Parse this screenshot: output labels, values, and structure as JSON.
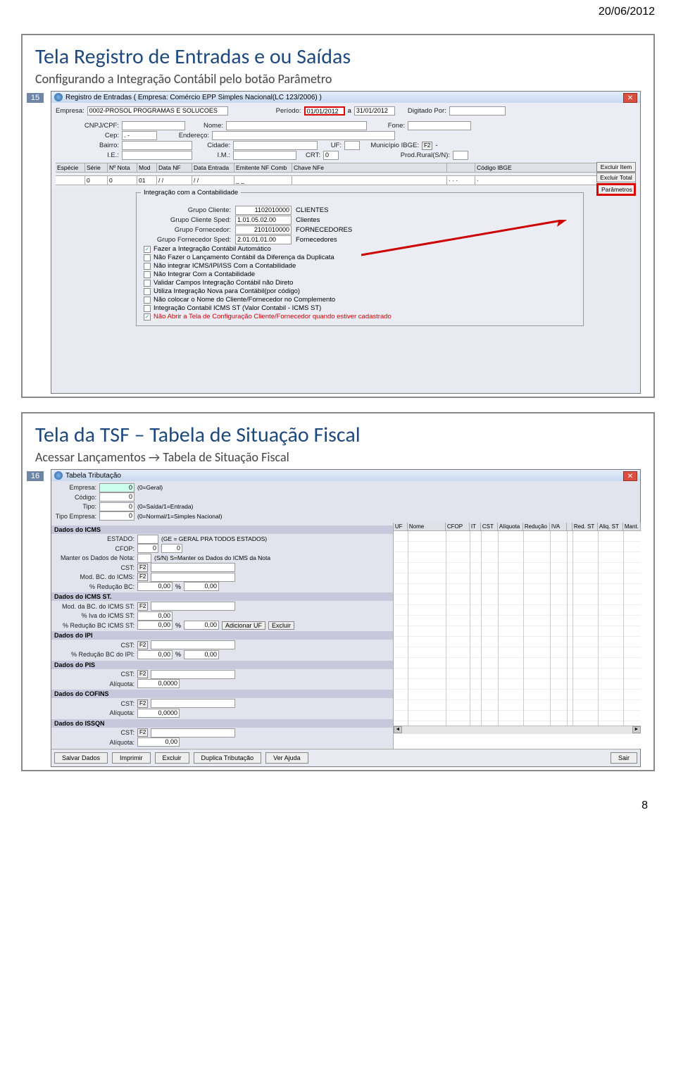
{
  "page": {
    "date": "20/06/2012",
    "footer_num": "8"
  },
  "slide1": {
    "num": "15",
    "title": "Tela Registro de Entradas  e ou Saídas",
    "subtitle": "Configurando  a Integração Contábil pelo botão Parâmetro",
    "win_title": "Registro de Entradas ( Empresa: Comércio  EPP Simples Nacional(LC 123/2006) )",
    "empresa_lbl": "Empresa:",
    "empresa_val": "0002-PROSOL PROGRAMAS E SOLUCOES",
    "periodo_lbl": "Período:",
    "periodo_de": "01/01/2012",
    "periodo_a_lbl": "a",
    "periodo_ate": "31/01/2012",
    "digitado_lbl": "Digitado Por:",
    "cnpj_lbl": "CNPJ/CPF:",
    "nome_lbl": "Nome:",
    "fone_lbl": "Fone:",
    "cep_lbl": "Cep:",
    "end_lbl": "Endereço:",
    "bairro_lbl": "Bairro:",
    "cidade_lbl": "Cidade:",
    "uf_lbl": "UF:",
    "municipio_lbl": "Município IBGE:",
    "ie_lbl": "I.E.:",
    "im_lbl": "I.M.:",
    "crt_lbl": "CRT:",
    "crt_val": "0",
    "prodrural_lbl": "Prod.Rural(S/N):",
    "f2": "F2",
    "dash": "-",
    "dots": ".  -",
    "grid_cols": [
      "Espécie",
      "Série",
      "Nº Nota",
      "Mod",
      "Data NF",
      "Data Entrada",
      "Emitente NF Comb",
      "Chave NFe",
      "",
      "Código IBGE"
    ],
    "grid_row": [
      "",
      "0",
      "0",
      "01",
      "/  /",
      "/  /",
      "_ _",
      "",
      "· · ·",
      "·"
    ],
    "btns": {
      "excluir_item": "Excluir Item",
      "excluir_total": "Excluir Total",
      "parametros": "Parâmetros"
    },
    "panel_title": "Integração com a Contabilidade",
    "grupo_cliente_lbl": "Grupo Cliente:",
    "grupo_cliente_val": "1102010000",
    "grupo_cliente_txt": "CLIENTES",
    "grupo_cliente_sped_lbl": "Grupo Cliente Sped:",
    "grupo_cliente_sped_val": "1.01.05.02.00",
    "grupo_cliente_sped_txt": "Clientes",
    "grupo_forn_lbl": "Grupo Fornecedor:",
    "grupo_forn_val": "2101010000",
    "grupo_forn_txt": "FORNECEDORES",
    "grupo_forn_sped_lbl": "Grupo Fornecedor Sped:",
    "grupo_forn_sped_val": "2.01.01.01.00",
    "grupo_forn_sped_txt": "Fornecedores",
    "chk1": "Fazer a Integração Contábil Automático",
    "chk2": "Não Fazer o Lançamento Contábil da Diferença da Duplicata",
    "chk3": "Não integrar ICMS/IPI/ISS Com a Contabilidade",
    "chk4": "Não Integrar Com a Contabilidade",
    "chk5": "Validar Campos Integração Contábil não Direto",
    "chk6": "Utiliza Integração Nova para Contábil(por código)",
    "chk7": "Não colocar o Nome do Cliente/Fornecedor no Complemento",
    "chk8": "Integração Contabil ICMS ST (Valor Contabil - ICMS ST)",
    "chk9": "Não Abrir a Tela de Configuração Cliente/Fornecedor quando estiver cadastrado"
  },
  "slide2": {
    "num": "16",
    "title": "Tela da TSF – Tabela de Situação Fiscal",
    "subtitle": "Acessar Lançamentos → Tabela de Situação Fiscal",
    "win_title": "Tabela Tributação",
    "empresa_lbl": "Empresa:",
    "empresa_val": "0",
    "empresa_hint": "(0=Geral)",
    "codigo_lbl": "Código:",
    "codigo_val": "0",
    "tipo_lbl": "Tipo:",
    "tipo_val": "0",
    "tipo_hint": "(0=Saída/1=Entrada)",
    "tipoemp_lbl": "Tipo Empresa:",
    "tipoemp_val": "0",
    "tipoemp_hint": "(0=Normal/1=Simples Nacional)",
    "sect_icms": "Dados do ICMS",
    "estado_lbl": "ESTADO:",
    "estado_hint": "(GE = GERAL PRA TODOS ESTADOS)",
    "cfop_lbl": "CFOP:",
    "cfop_v1": "0",
    "cfop_v2": "0",
    "manter_lbl": "Manter os Dados de Nota:",
    "manter_hint": "(S/N)  S=Manter os Dados do ICMS da Nota",
    "cst_lbl": "CST:",
    "modbc_lbl": "Mod. BC. do ICMS:",
    "redbc_lbl": "% Redução BC:",
    "zero2": "0,00",
    "pct": "%",
    "sect_icmsst": "Dados do ICMS ST.",
    "modbcst_lbl": "Mod. da BC. do ICMS ST:",
    "ivast_lbl": "% Iva do ICMS ST:",
    "redbcst_lbl": "% Redução BC ICMS ST:",
    "add_uf": "Adicionar UF",
    "excluir": "Excluir",
    "sect_ipi": "Dados do IPI",
    "redbcipi_lbl": "% Redução BC do IPI:",
    "sect_pis": "Dados do PIS",
    "aliq_lbl": "Alíquota:",
    "aliq4": "0,0000",
    "sect_cofins": "Dados do COFINS",
    "sect_issqn": "Dados do ISSQN",
    "f2": "F2",
    "right_cols": [
      "UF",
      "Nome",
      "CFOP",
      "IT",
      "CST",
      "Alíquota",
      "Redução",
      "IVA",
      "",
      "Red. ST",
      "Aliq. ST",
      "Mant."
    ],
    "btn_salvar": "Salvar Dados",
    "btn_imprimir": "Imprimir",
    "btn_excluir": "Excluir",
    "btn_duplica": "Duplica Tributação",
    "btn_ajuda": "Ver Ajuda",
    "btn_sair": "Sair",
    "arrow_l": "◄",
    "arrow_r": "►"
  }
}
